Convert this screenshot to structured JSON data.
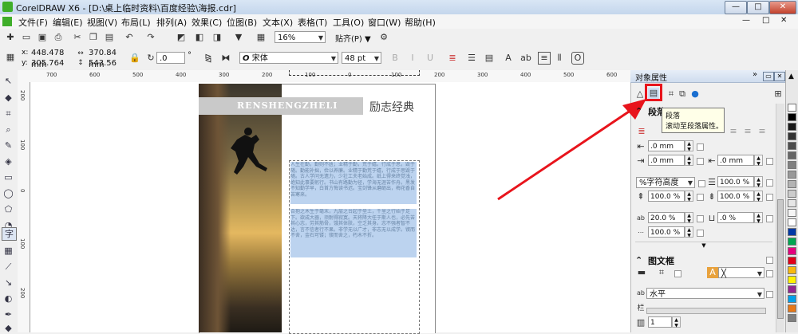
{
  "app": {
    "title": "CorelDRAW X6 - [D:\\桌上临时资料\\百度经验\\海报.cdr]",
    "window_controls": [
      "—",
      "□",
      "✕"
    ],
    "doc_controls": [
      "—",
      "□",
      "✕"
    ]
  },
  "menu": [
    {
      "label": "文件(F)"
    },
    {
      "label": "编辑(E)"
    },
    {
      "label": "视图(V)"
    },
    {
      "label": "布局(L)"
    },
    {
      "label": "排列(A)"
    },
    {
      "label": "效果(C)"
    },
    {
      "label": "位图(B)"
    },
    {
      "label": "文本(X)"
    },
    {
      "label": "表格(T)"
    },
    {
      "label": "工具(O)"
    },
    {
      "label": "窗口(W)"
    },
    {
      "label": "帮助(H)"
    }
  ],
  "toolbar": {
    "zoom": "16%",
    "snap": "贴齐(P)"
  },
  "propbar": {
    "x": "448.478 mm",
    "y": "305.764 mm",
    "x_label": "x:",
    "y_label": "y:",
    "width": "370.84 mm",
    "height": "543.56 mm",
    "rotation": ".0",
    "rotation_unit": "°",
    "font": "宋体",
    "font_glyph": "O",
    "font_size": "48 pt"
  },
  "rulers": {
    "h_ticks": [
      "700",
      "600",
      "500",
      "400",
      "300",
      "200",
      "100",
      "0",
      "100",
      "200",
      "300",
      "400",
      "500",
      "600"
    ],
    "v_ticks": [
      "200",
      "100",
      "0",
      "100",
      "200"
    ]
  },
  "poster": {
    "banner": "RENSHENGZHELI",
    "subtitle": "励志经典",
    "para1": "人生在勤，勤则不匮；业精于勤，荒于嬉。行成于思，毁于随。勤能补拙，俭以养廉。业精于勤荒于嬉，行成于思毁于随。古人学问无遗力，少壮工夫老始成。纸上得来终觉浅，绝知此事要躬行。书山有路勤为径，学海无涯苦作舟。黑发不知勤学早，白首方悔读书迟。宝剑锋从磨砺出，梅花香自苦寒来。",
    "para2": "合抱之木生于毫末，九层之台起于垒土，千里之行始于足下。欲成大器，须耐得寂寞。天将降大任于斯人也，必先苦其心志，劳其筋骨，饿其体肤，空乏其身。志不强者智不达，言不信者行不果。非学无以广才，非志无以成学。锲而不舍，金石可镂；锲而舍之，朽木不折。"
  },
  "docker": {
    "title": "对象属性",
    "section_paragraph": "段落",
    "tooltip_title": "段落",
    "tooltip_desc": "滚动至段落属性。",
    "fields": {
      "indent1": ".0 mm",
      "indent2": ".0 mm",
      "indent3": ".0 mm",
      "indent4": ".0 mm",
      "line_spacing_mode": "%字符高度",
      "line_spacing": "100.0 %",
      "before_para": "100.0 %",
      "after_para": "100.0 %",
      "char_spacing": "20.0 %",
      "word_spacing": ".0 %",
      "lang_spacing": "100.0 %"
    },
    "section_frame": "图文框",
    "frame_direction": "水平",
    "columns": "1"
  },
  "palette_colors": [
    "#ffffff",
    "#000000",
    "#1a1a1a",
    "#333333",
    "#4d4d4d",
    "#666666",
    "#808080",
    "#999999",
    "#b3b3b3",
    "#cccccc",
    "#e6e6e6",
    "#f5f5f5",
    "#ffffff",
    "#0039a6",
    "#00a651",
    "#e5007e",
    "#e10019",
    "#f7b90f",
    "#fff100",
    "#92278f",
    "#00a0e9",
    "#e87817",
    "#7f7f7f"
  ]
}
